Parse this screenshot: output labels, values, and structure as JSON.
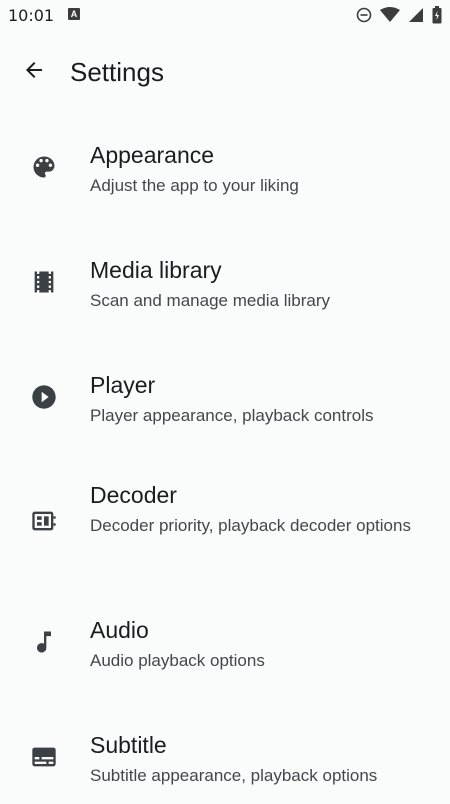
{
  "status_bar": {
    "time": "10:01",
    "notification_badge": "A",
    "icons": [
      "do-not-disturb-icon",
      "wifi-icon",
      "cellular-signal-icon",
      "battery-icon"
    ]
  },
  "header": {
    "back_icon": "arrow-back-icon",
    "title": "Settings"
  },
  "settings": [
    {
      "icon": "palette-icon",
      "title": "Appearance",
      "subtitle": "Adjust the app to your liking"
    },
    {
      "icon": "film-strip-icon",
      "title": "Media library",
      "subtitle": "Scan and manage media library"
    },
    {
      "icon": "play-circle-icon",
      "title": "Player",
      "subtitle": "Player appearance, playback controls"
    },
    {
      "icon": "decoder-chip-icon",
      "title": "Decoder",
      "subtitle": "Decoder priority, playback decoder options"
    },
    {
      "icon": "music-note-icon",
      "title": "Audio",
      "subtitle": "Audio playback options"
    },
    {
      "icon": "subtitles-icon",
      "title": "Subtitle",
      "subtitle": "Subtitle appearance, playback options"
    }
  ],
  "colors": {
    "background": "#fafcfc",
    "text_primary": "#1b1c1e",
    "text_secondary": "#44474a",
    "icon": "#3a4044"
  }
}
